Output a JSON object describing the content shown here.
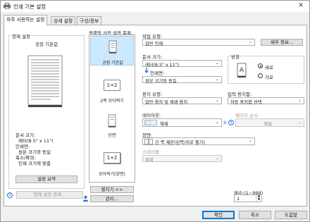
{
  "window": {
    "title": "인쇄 기본 설정"
  },
  "tabs": [
    {
      "label": "자주 사용하는 설정"
    },
    {
      "label": "상세 설정"
    },
    {
      "label": "구성/정보"
    }
  ],
  "current_settings": {
    "group_title": "현재 설정",
    "preset_name": "공장 기본값",
    "summary_lines": [
      "문서 크기:",
      "레터(8.5\" x 11\")",
      "인쇄면:",
      "원본 크기와 동일",
      "축소/확대:",
      "인쇄 크기에 맞춤"
    ],
    "summary_button": "설정 요약",
    "save_button": "현재 설정 등록..."
  },
  "shortcuts": {
    "group_title": "원클릭 사전 설정 목록:",
    "items": [
      {
        "label": "공장 기본값",
        "icon": "page"
      },
      {
        "label": "2쪽 모아찍기",
        "icon": "1+2"
      },
      {
        "label": "단면",
        "icon": "page"
      },
      {
        "label": "모아찍기(양면)",
        "icon": "1+2"
      }
    ],
    "list_button": "펼치기 >>",
    "manage_button": "관리..."
  },
  "job_type": {
    "label": "작업 유형:",
    "value": "일반 인쇄",
    "details_button": "세부 정보..."
  },
  "doc_size": {
    "label": "문서 크기:",
    "value": "레터(8.5\" x 11\")"
  },
  "print_on": {
    "label": "인쇄면:",
    "value": "원본 크기와 동일"
  },
  "orientation": {
    "label": "방향",
    "options": [
      "세로",
      "가로"
    ],
    "selected": "세로"
  },
  "paper_type": {
    "label": "용지 유형:",
    "value": "일반 용지 및 재생 용지"
  },
  "input_tray": {
    "label": "입력 용지함:",
    "value": "자동 용지함 선택"
  },
  "layout": {
    "label": "레이아웃:",
    "value": "해제"
  },
  "page_order": {
    "label": "페이지 순서:",
    "value": "해제"
  },
  "duplex": {
    "label": "양면:",
    "value": "긴 쪽 제본(왼쪽/위로 펼기)"
  },
  "staple": {
    "label": "스테이플:",
    "value": "해제"
  },
  "copies": {
    "label": "매수:(1~999)",
    "value": "1"
  },
  "footer": {
    "ok": "확인",
    "cancel": "취소",
    "help": "도움말"
  },
  "colors": {
    "selection": "#cce8ff",
    "accent": "#0078d7",
    "info": "#1f6fcf"
  }
}
